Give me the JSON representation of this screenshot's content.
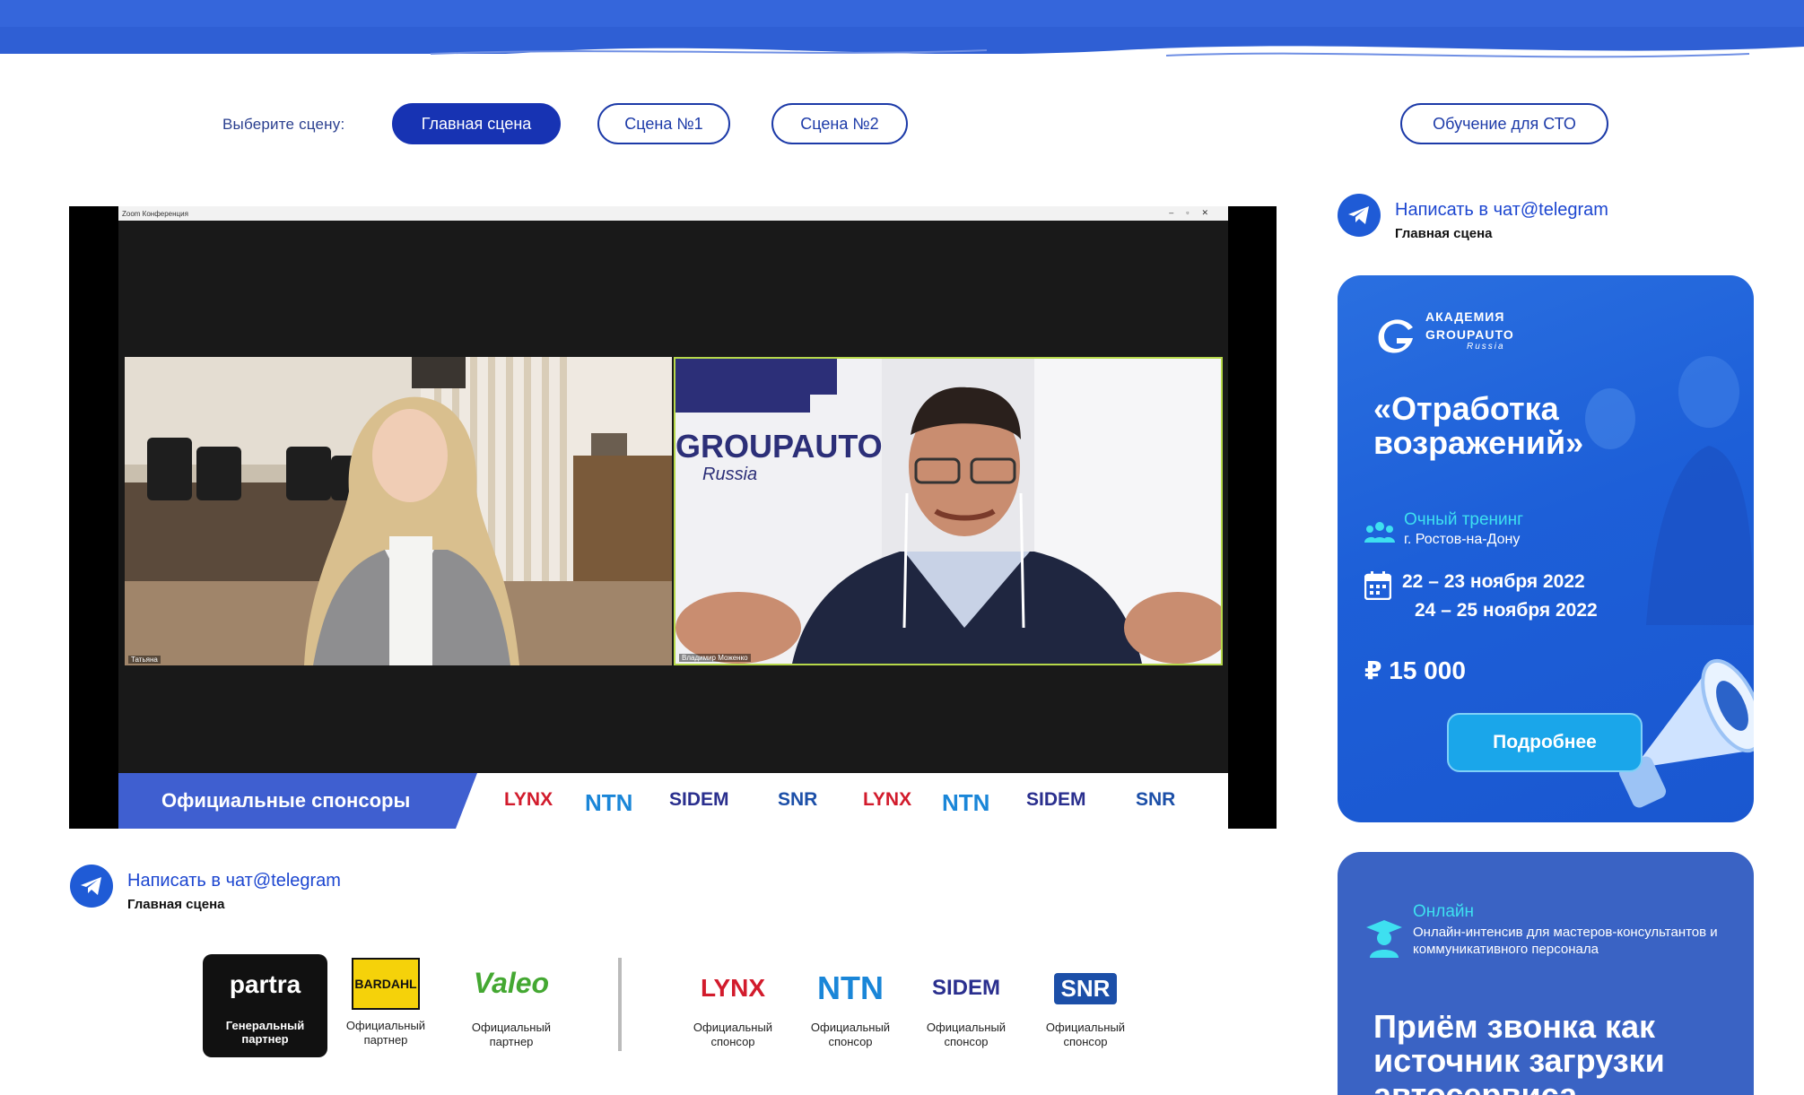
{
  "scene_selector": {
    "label": "Выберите сцену:",
    "scenes": [
      "Главная сцена",
      "Сцена №1",
      "Сцена №2"
    ],
    "active": "Главная сцена",
    "training_button": "Обучение для СТО"
  },
  "video": {
    "window_title": "Zoom Конференция",
    "participant_left": "Татьяна",
    "participant_right": "Владимир Моженко",
    "background_text": "GROUPAUTO",
    "background_subtext": "Russia",
    "sponsors_label": "Официальные спонсоры",
    "strip_logos": [
      "LYNX",
      "NTN",
      "SIDEM",
      "SNR",
      "LYNX",
      "NTN",
      "SIDEM",
      "SNR"
    ]
  },
  "telegram_top": {
    "link": "Написать в чат@telegram",
    "scene": "Главная сцена"
  },
  "telegram_bottom": {
    "link": "Написать в чат@telegram",
    "scene": "Главная сцена"
  },
  "partners": [
    {
      "name": "partra",
      "caption_line1": "Генеральный",
      "caption_line2": "партнер"
    },
    {
      "name": "BARDAHL",
      "caption_line1": "Официальный",
      "caption_line2": "партнер"
    },
    {
      "name": "Valeo",
      "caption_line1": "Официальный",
      "caption_line2": "партнер"
    },
    {
      "name": "LYNX",
      "caption_line1": "Официальный",
      "caption_line2": "спонсор"
    },
    {
      "name": "NTN",
      "caption_line1": "Официальный",
      "caption_line2": "спонсор"
    },
    {
      "name": "SIDEM",
      "caption_line1": "Официальный",
      "caption_line2": "спонсор"
    },
    {
      "name": "SNR",
      "caption_line1": "Официальный",
      "caption_line2": "спонсор"
    }
  ],
  "promo_card": {
    "academy_top": "АКАДЕМИЯ",
    "academy_brand": "GROUPAUTO",
    "academy_region": "Russia",
    "title_line1": "«Отработка",
    "title_line2": "возражений»",
    "format": "Очный тренинг",
    "city": "г. Ростов-на-Дону",
    "date1": "22 – 23 ноября 2022",
    "date2": "24 – 25 ноября 2022",
    "price": "₽  15 000",
    "button": "Подробнее"
  },
  "promo_card_2": {
    "format": "Онлайн",
    "description": "Онлайн-интенсив для мастеров-консультантов и коммуникативного персонала",
    "title": "Приём звонка как источник загрузки автосервиса"
  },
  "colors": {
    "primary": "#1733b3",
    "telegram": "#1f5bd6",
    "promo_blue": "#1d5fd8",
    "accent_cyan": "#3ee0f0"
  }
}
